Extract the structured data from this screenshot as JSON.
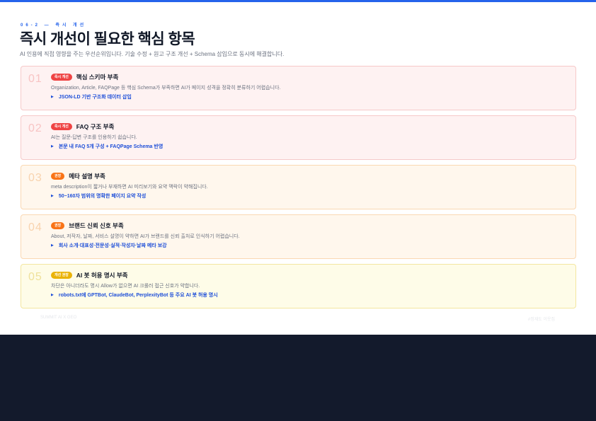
{
  "header": {
    "kicker": "06-2 — 즉시 개선",
    "title": "즉시 개선이 필요한 핵심 항목",
    "subtitle": "AI 인용에 직접 영향을 주는 우선순위입니다. 기술 수정 + 원고 구조 개선 + Schema 삽입으로 동시에 해결합니다."
  },
  "items": [
    {
      "num": "01",
      "badge": "즉시 개선",
      "title": "핵심 스키마 부족",
      "desc": "Organization, Article, FAQPage 등 핵심 Schema가 부족하면 AI가 페이지 성격을 정확히 분류하기 어렵습니다.",
      "action": "JSON-LD 기반 구조화 데이터 삽입"
    },
    {
      "num": "02",
      "badge": "즉시 개선",
      "title": "FAQ 구조 부족",
      "desc": "AI는 질문-답변 구조를 인용하기 쉽습니다.",
      "action": "본문 내 FAQ 5개 구성 + FAQPage Schema 반영"
    },
    {
      "num": "03",
      "badge": "권장",
      "title": "메타 설명 부족",
      "desc": "meta description이 짧거나 부재하면 AI 미리보기와 요약 맥락이 약해집니다.",
      "action": "50~160자 범위의 명확한 페이지 요약 작성"
    },
    {
      "num": "04",
      "badge": "권장",
      "title": "브랜드 신뢰 신호 부족",
      "desc": "About, 저작자, 날짜, 서비스 설명이 약하면 AI가 브랜드를 신뢰 출처로 인식하기 어렵습니다.",
      "action": "회사 소개·대표성·전문성·실적·작성자·날짜 메타 보강"
    },
    {
      "num": "05",
      "badge": "개선 권장",
      "title": "AI 봇 허용 명시 부족",
      "desc": "차단은 아니더라도 명시 Allow가 없으면 AI 크롤러 접근 신호가 약합니다.",
      "action": "robots.txt에 GPTBot, ClaudeBot, PerplexityBot 등 주요 AI 봇 허용 명시"
    }
  ],
  "footer": {
    "left": "SUMMIT AI X GEO",
    "right": "#정재도 이웃집"
  },
  "colors": {
    "accent": "#2563eb",
    "urgent": "#ef4444",
    "recommended": "#f97316",
    "improve": "#eab308",
    "dark_bg": "#131a2c"
  }
}
